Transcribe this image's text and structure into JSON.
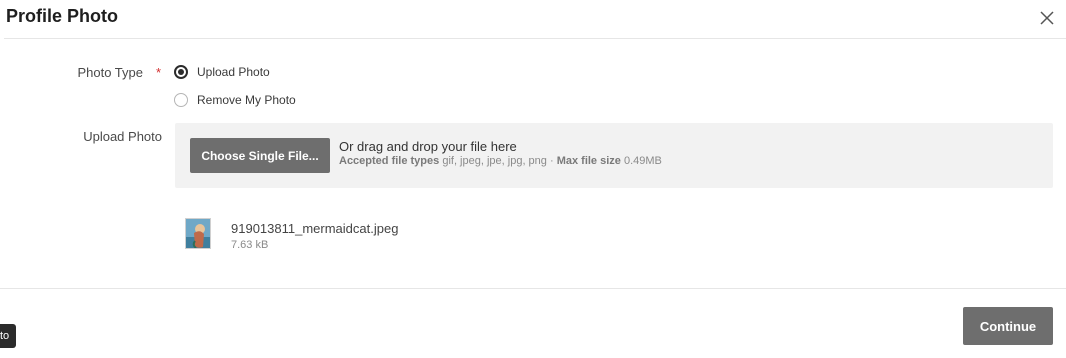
{
  "dialog": {
    "title": "Profile Photo"
  },
  "form": {
    "photo_type_label": "Photo Type",
    "required_marker": "*",
    "required_color": "#d32f2f",
    "options": [
      {
        "label": "Upload Photo",
        "selected": true
      },
      {
        "label": "Remove My Photo",
        "selected": false
      }
    ],
    "upload_label": "Upload Photo"
  },
  "dropzone": {
    "button_label": "Choose Single File...",
    "drag_text": "Or drag and drop your file here",
    "types_label": "Accepted file types",
    "types_value": "gif, jpeg, jpe, jpg, png",
    "separator": "·",
    "size_label": "Max file size",
    "size_value": "0.49MB"
  },
  "file": {
    "name": "919013811_mermaidcat.jpeg",
    "size": "7.63 kB"
  },
  "footer": {
    "continue_label": "Continue",
    "tooltip_fragment": "to"
  },
  "icons": {
    "close": "close-icon",
    "thumbnail": "image-thumbnail"
  },
  "colors": {
    "button_bg": "#6e6e6e",
    "dropzone_bg": "#f2f2f2"
  }
}
